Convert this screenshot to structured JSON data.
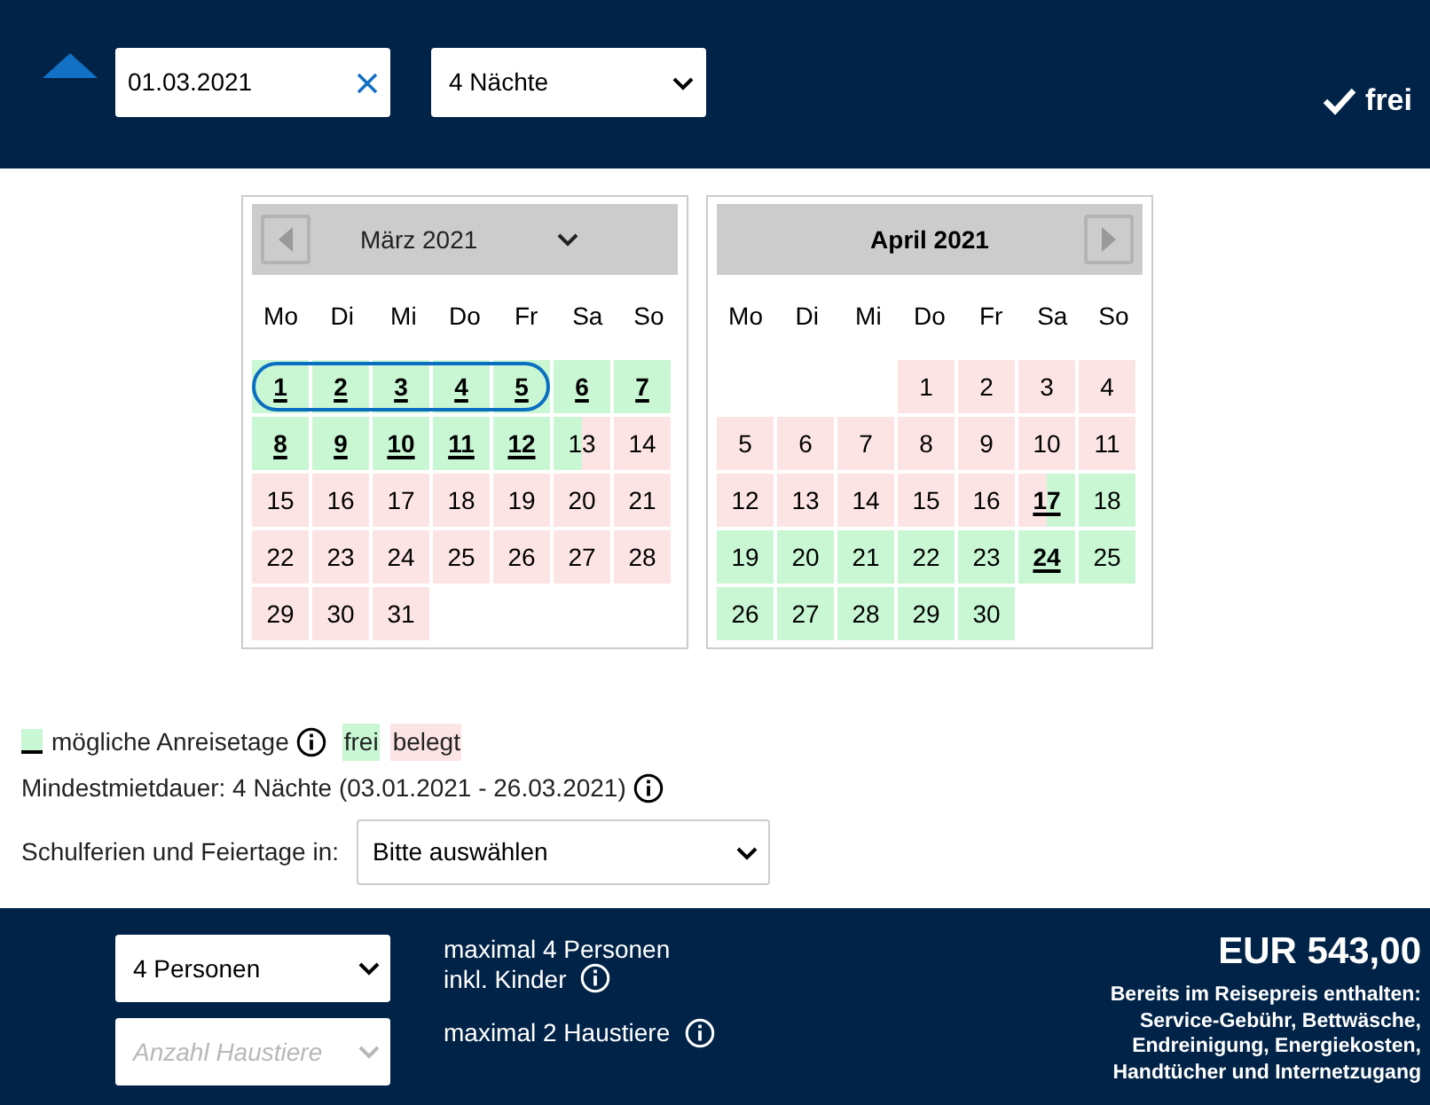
{
  "top_bar": {
    "date_field": {
      "value": "01.03.2021"
    },
    "nights_select": {
      "value": "4 Nächte"
    },
    "availability": "frei"
  },
  "months": [
    {
      "title": "März 2021",
      "prev_button": true,
      "next_button": false,
      "dropdown": true,
      "weekdays": [
        "Mo",
        "Di",
        "Mi",
        "Do",
        "Fr",
        "Sa",
        "So"
      ],
      "weeks": [
        [
          {
            "day": "1",
            "kind": "free",
            "arrival": true,
            "selected": true
          },
          {
            "day": "2",
            "kind": "free",
            "arrival": true,
            "selected": true
          },
          {
            "day": "3",
            "kind": "free",
            "arrival": true,
            "selected": true
          },
          {
            "day": "4",
            "kind": "free",
            "arrival": true,
            "selected": true
          },
          {
            "day": "5",
            "kind": "free",
            "arrival": true,
            "selected": true
          },
          {
            "day": "6",
            "kind": "free",
            "arrival": true,
            "selected": false
          },
          {
            "day": "7",
            "kind": "free",
            "arrival": true,
            "selected": false
          }
        ],
        [
          {
            "day": "8",
            "kind": "free",
            "arrival": true,
            "selected": false
          },
          {
            "day": "9",
            "kind": "free",
            "arrival": true,
            "selected": false
          },
          {
            "day": "10",
            "kind": "free",
            "arrival": true,
            "selected": false
          },
          {
            "day": "11",
            "kind": "free",
            "arrival": true,
            "selected": false
          },
          {
            "day": "12",
            "kind": "free",
            "arrival": true,
            "selected": false
          },
          {
            "day": "13",
            "kind": "free_booked",
            "arrival": false,
            "selected": false
          },
          {
            "day": "14",
            "kind": "booked",
            "arrival": false,
            "selected": false
          }
        ],
        [
          {
            "day": "15",
            "kind": "booked",
            "arrival": false,
            "selected": false
          },
          {
            "day": "16",
            "kind": "booked",
            "arrival": false,
            "selected": false
          },
          {
            "day": "17",
            "kind": "booked",
            "arrival": false,
            "selected": false
          },
          {
            "day": "18",
            "kind": "booked",
            "arrival": false,
            "selected": false
          },
          {
            "day": "19",
            "kind": "booked",
            "arrival": false,
            "selected": false
          },
          {
            "day": "20",
            "kind": "booked",
            "arrival": false,
            "selected": false
          },
          {
            "day": "21",
            "kind": "booked",
            "arrival": false,
            "selected": false
          }
        ],
        [
          {
            "day": "22",
            "kind": "booked",
            "arrival": false,
            "selected": false
          },
          {
            "day": "23",
            "kind": "booked",
            "arrival": false,
            "selected": false
          },
          {
            "day": "24",
            "kind": "booked",
            "arrival": false,
            "selected": false
          },
          {
            "day": "25",
            "kind": "booked",
            "arrival": false,
            "selected": false
          },
          {
            "day": "26",
            "kind": "booked",
            "arrival": false,
            "selected": false
          },
          {
            "day": "27",
            "kind": "booked",
            "arrival": false,
            "selected": false
          },
          {
            "day": "28",
            "kind": "booked",
            "arrival": false,
            "selected": false
          }
        ],
        [
          {
            "day": "29",
            "kind": "booked",
            "arrival": false,
            "selected": false
          },
          {
            "day": "30",
            "kind": "booked",
            "arrival": false,
            "selected": false
          },
          {
            "day": "31",
            "kind": "booked",
            "arrival": false,
            "selected": false
          }
        ]
      ]
    },
    {
      "title": "April 2021",
      "prev_button": false,
      "next_button": true,
      "dropdown": false,
      "weekdays": [
        "Mo",
        "Di",
        "Mi",
        "Do",
        "Fr",
        "Sa",
        "So"
      ],
      "weeks": [
        [
          {
            "kind": "empty"
          },
          {
            "kind": "empty"
          },
          {
            "kind": "empty"
          },
          {
            "day": "1",
            "kind": "booked",
            "arrival": false,
            "selected": false
          },
          {
            "day": "2",
            "kind": "booked",
            "arrival": false,
            "selected": false
          },
          {
            "day": "3",
            "kind": "booked",
            "arrival": false,
            "selected": false
          },
          {
            "day": "4",
            "kind": "booked",
            "arrival": false,
            "selected": false
          }
        ],
        [
          {
            "day": "5",
            "kind": "booked",
            "arrival": false,
            "selected": false
          },
          {
            "day": "6",
            "kind": "booked",
            "arrival": false,
            "selected": false
          },
          {
            "day": "7",
            "kind": "booked",
            "arrival": false,
            "selected": false
          },
          {
            "day": "8",
            "kind": "booked",
            "arrival": false,
            "selected": false
          },
          {
            "day": "9",
            "kind": "booked",
            "arrival": false,
            "selected": false
          },
          {
            "day": "10",
            "kind": "booked",
            "arrival": false,
            "selected": false
          },
          {
            "day": "11",
            "kind": "booked",
            "arrival": false,
            "selected": false
          }
        ],
        [
          {
            "day": "12",
            "kind": "booked",
            "arrival": false,
            "selected": false
          },
          {
            "day": "13",
            "kind": "booked",
            "arrival": false,
            "selected": false
          },
          {
            "day": "14",
            "kind": "booked",
            "arrival": false,
            "selected": false
          },
          {
            "day": "15",
            "kind": "booked",
            "arrival": false,
            "selected": false
          },
          {
            "day": "16",
            "kind": "booked",
            "arrival": false,
            "selected": false
          },
          {
            "day": "17",
            "kind": "booked_free",
            "arrival": true,
            "selected": false
          },
          {
            "day": "18",
            "kind": "free",
            "arrival": false,
            "selected": false
          }
        ],
        [
          {
            "day": "19",
            "kind": "free",
            "arrival": false,
            "selected": false
          },
          {
            "day": "20",
            "kind": "free",
            "arrival": false,
            "selected": false
          },
          {
            "day": "21",
            "kind": "free",
            "arrival": false,
            "selected": false
          },
          {
            "day": "22",
            "kind": "free",
            "arrival": false,
            "selected": false
          },
          {
            "day": "23",
            "kind": "free",
            "arrival": false,
            "selected": false
          },
          {
            "day": "24",
            "kind": "free",
            "arrival": true,
            "selected": false
          },
          {
            "day": "25",
            "kind": "free",
            "arrival": false,
            "selected": false
          }
        ],
        [
          {
            "day": "26",
            "kind": "free",
            "arrival": false,
            "selected": false
          },
          {
            "day": "27",
            "kind": "free",
            "arrival": false,
            "selected": false
          },
          {
            "day": "28",
            "kind": "free",
            "arrival": false,
            "selected": false
          },
          {
            "day": "29",
            "kind": "free",
            "arrival": false,
            "selected": false
          },
          {
            "day": "30",
            "kind": "free",
            "arrival": false,
            "selected": false
          }
        ]
      ]
    }
  ],
  "legend": {
    "arrival_label": "mögliche Anreisetage",
    "free": "frei",
    "booked": "belegt"
  },
  "min_stay": "Mindestmietdauer: 4 Nächte (03.01.2021 - 26.03.2021)",
  "holidays": {
    "label": "Schulferien und Feiertage in:",
    "select": {
      "value": "Bitte auswählen"
    }
  },
  "bottom_bar": {
    "persons_select": {
      "value": "4 Personen"
    },
    "pets_select": {
      "placeholder": "Anzahl Haustiere"
    },
    "max_persons": [
      "maximal 4 Personen",
      "inkl. Kinder"
    ],
    "max_pets": "maximal 2 Haustiere",
    "price": "EUR 543,00",
    "included": [
      "Bereits im Reisepreis enthalten:",
      "Service-Gebühr, Bettwäsche,",
      "Endreinigung, Energiekosten,",
      "Handtücher und Internetzugang"
    ]
  }
}
